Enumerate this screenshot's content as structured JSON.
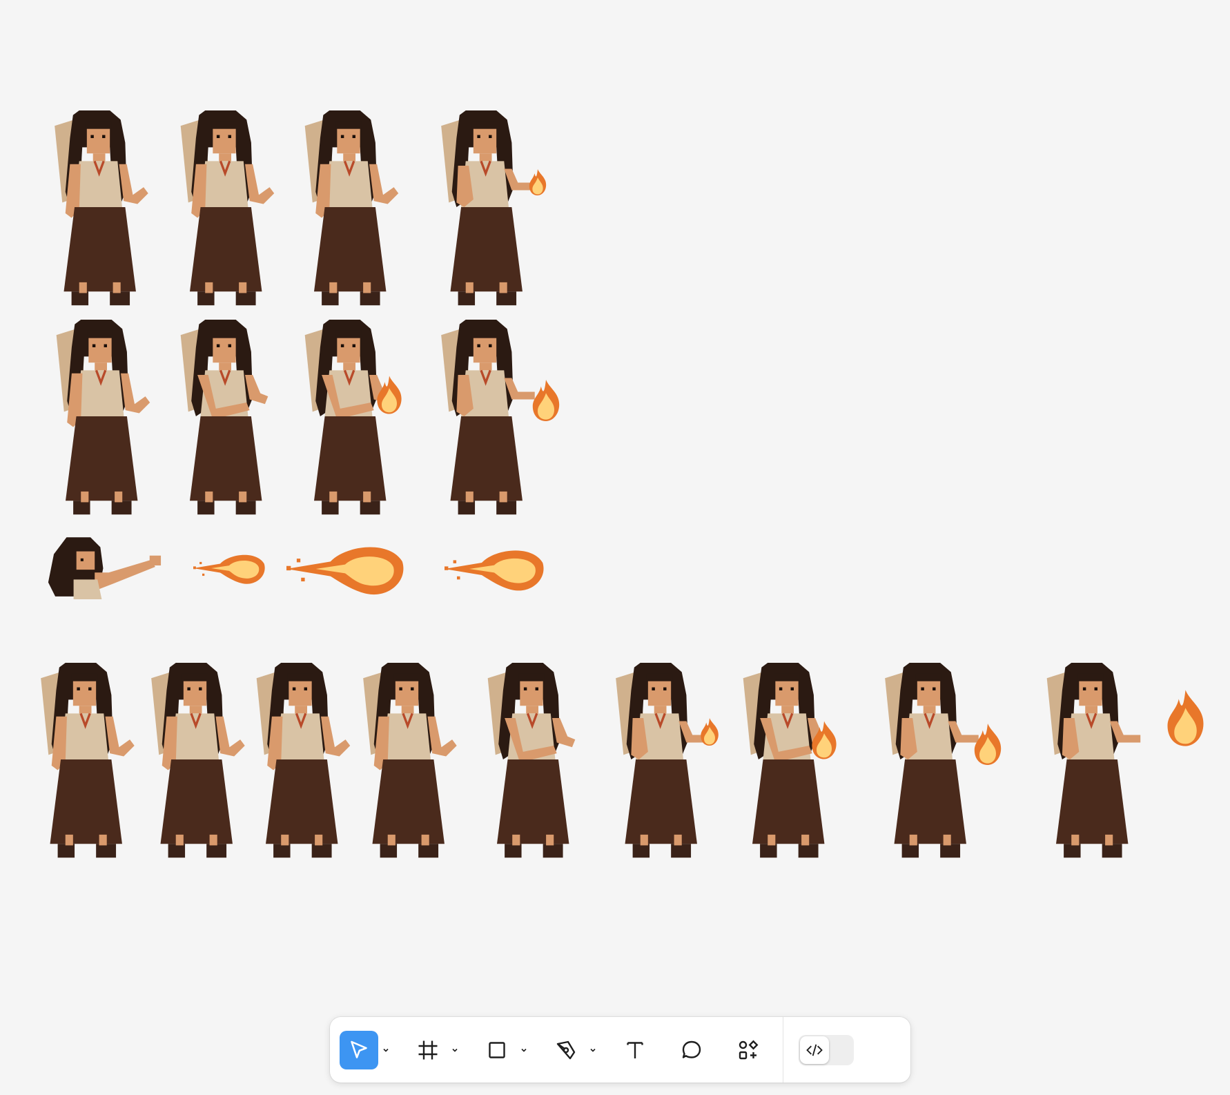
{
  "canvas": {
    "background": "#f5f5f5",
    "sheet": {
      "rows": [
        {
          "frames": [
            "idle",
            "idle",
            "idle",
            "hold-ember"
          ]
        },
        {
          "frames": [
            "idle",
            "charge",
            "flame-rise",
            "cast-flame"
          ]
        }
      ],
      "effects_row": [
        "cast-pose",
        "fireball-small",
        "fireball-medium",
        "fireball-large"
      ]
    },
    "strip": {
      "frames": [
        "idle",
        "idle",
        "idle",
        "idle",
        "charge",
        "hold-ember",
        "flame-rise",
        "cast-flame",
        "cast-release"
      ]
    },
    "colors": {
      "hair": "#2b1a12",
      "skin": "#d99a6c",
      "top": "#d9c3a5",
      "skirt": "#4a2a1c",
      "wing": "#c9a57a",
      "boots": "#3a2218",
      "flame_core": "#ffd27a",
      "flame_outer": "#e8772a"
    }
  },
  "toolbar": {
    "tools": [
      {
        "name": "move-tool",
        "icon": "cursor-arrow-icon",
        "active": true,
        "has_menu": true
      },
      {
        "name": "frame-tool",
        "icon": "hash-frame-icon",
        "active": false,
        "has_menu": true
      },
      {
        "name": "shape-tool",
        "icon": "rectangle-icon",
        "active": false,
        "has_menu": true
      },
      {
        "name": "pen-tool",
        "icon": "pen-nib-icon",
        "active": false,
        "has_menu": true
      },
      {
        "name": "text-tool",
        "icon": "text-t-icon",
        "active": false,
        "has_menu": false
      },
      {
        "name": "comment-tool",
        "icon": "speech-bubble-icon",
        "active": false,
        "has_menu": false
      },
      {
        "name": "assets-tool",
        "icon": "shapes-plus-icon",
        "active": false,
        "has_menu": false
      }
    ],
    "dev_mode": {
      "icon": "code-brackets-icon",
      "enabled": false
    },
    "accent": "#3d95f2"
  }
}
